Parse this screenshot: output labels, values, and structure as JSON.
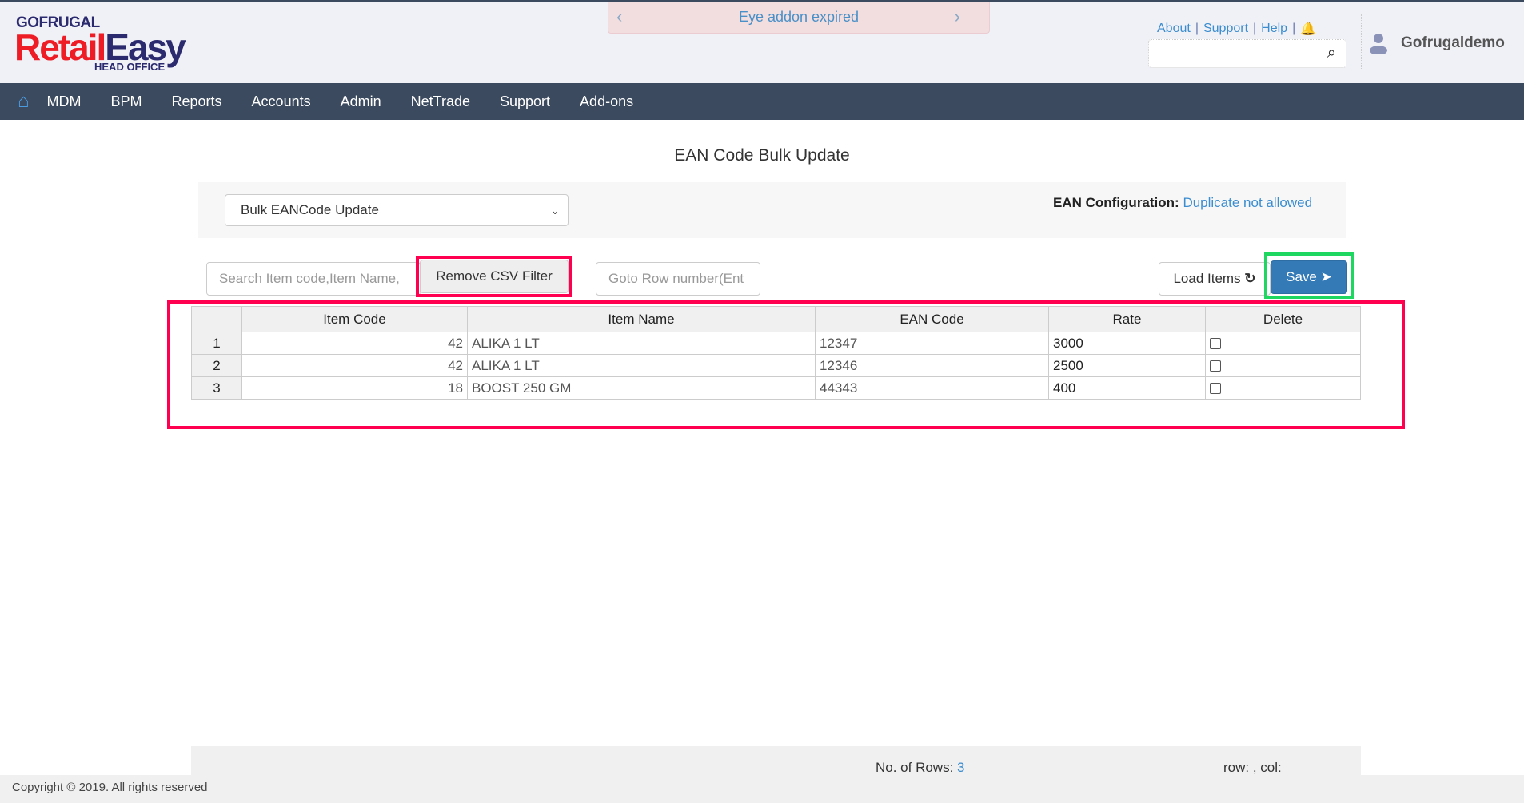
{
  "header": {
    "logo_top": "GOFRUGAL",
    "logo_retail": "Retail",
    "logo_easy": "Easy",
    "logo_sub": "HEAD OFFICE",
    "banner": "Eye addon expired",
    "links": [
      "About",
      "Support",
      "Help"
    ],
    "user": "Gofrugaldemo"
  },
  "nav": [
    "MDM",
    "BPM",
    "Reports",
    "Accounts",
    "Admin",
    "NetTrade",
    "Support",
    "Add-ons"
  ],
  "page": {
    "title": "EAN Code Bulk Update",
    "select_value": "Bulk EANCode Update",
    "ean_config_label": "EAN Configuration:",
    "ean_config_value": "Duplicate not allowed"
  },
  "toolbar": {
    "search_placeholder": "Search Item code,Item Name,",
    "remove_csv": "Remove CSV Filter",
    "goto_placeholder": "Goto Row number(Ent",
    "load_items": "Load Items",
    "save": "Save"
  },
  "table": {
    "headers": [
      "",
      "Item Code",
      "Item Name",
      "EAN Code",
      "Rate",
      "Delete"
    ],
    "rows": [
      {
        "n": "1",
        "code": "42",
        "name": "ALIKA 1 LT",
        "ean": "12347",
        "rate": "3000"
      },
      {
        "n": "2",
        "code": "42",
        "name": "ALIKA 1 LT",
        "ean": "12346",
        "rate": "2500"
      },
      {
        "n": "3",
        "code": "18",
        "name": "BOOST 250 GM",
        "ean": "44343",
        "rate": "400"
      }
    ]
  },
  "footer": {
    "rows_label": "No. of Rows:",
    "rows_value": "3",
    "rowcol": "row: , col:",
    "copyright": "Copyright © 2019. All rights reserved"
  },
  "colors": {
    "nav": "#3b4a5f",
    "accent": "#337ab7",
    "highlight_red": "#ff0050",
    "highlight_green": "#1ed760"
  }
}
